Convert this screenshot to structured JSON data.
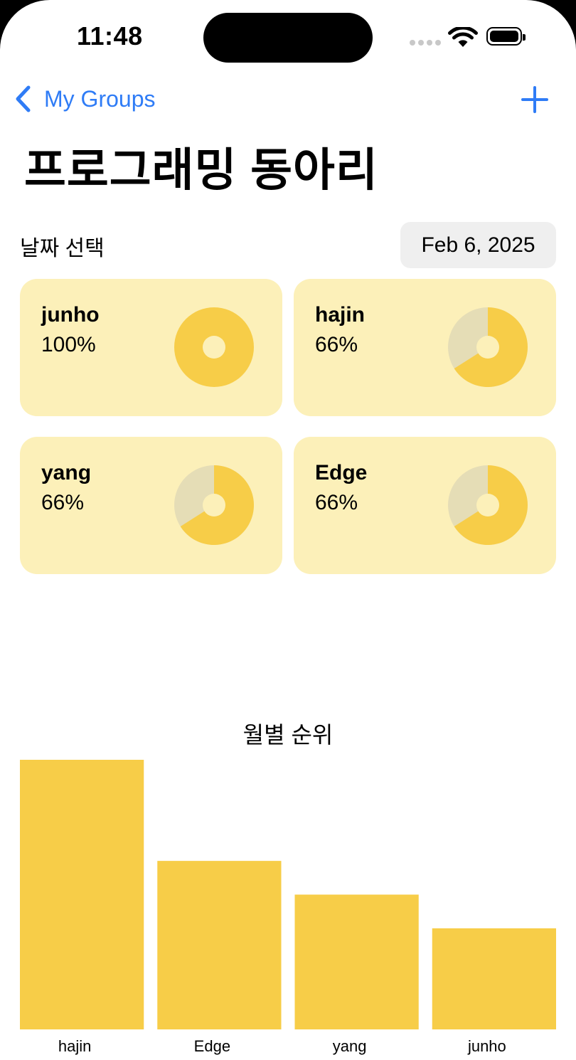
{
  "status_bar": {
    "time": "11:48"
  },
  "nav": {
    "back_label": "My Groups"
  },
  "page": {
    "title": "프로그래밍 동아리"
  },
  "date_picker": {
    "label": "날짜 선택",
    "value": "Feb 6, 2025"
  },
  "members": [
    {
      "name": "junho",
      "percent": "100%",
      "ratio": 1.0
    },
    {
      "name": "hajin",
      "percent": "66%",
      "ratio": 0.66
    },
    {
      "name": "yang",
      "percent": "66%",
      "ratio": 0.66
    },
    {
      "name": "Edge",
      "percent": "66%",
      "ratio": 0.66
    }
  ],
  "colors": {
    "accent": "#2f7cf6",
    "card_bg": "#fcf0b9",
    "donut_fill": "#f7cd48",
    "donut_rest": "#e5ddb6",
    "bar": "#f7cd48"
  },
  "chart_data": {
    "type": "bar",
    "title": "월별 순위",
    "categories": [
      "hajin",
      "Edge",
      "yang",
      "junho"
    ],
    "values": [
      8,
      5,
      4,
      3
    ],
    "ylim": [
      0,
      8
    ],
    "grid": false
  }
}
